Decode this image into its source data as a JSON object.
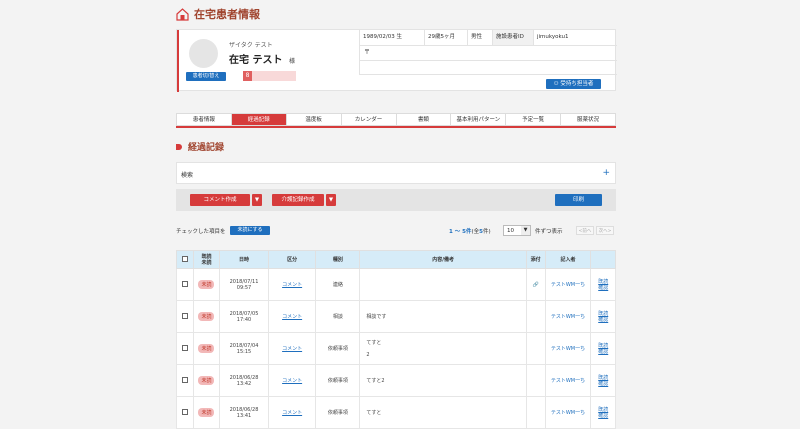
{
  "page": {
    "title": "在宅患者情報"
  },
  "patient": {
    "kana": "ザイタク テスト",
    "name": "在宅 テスト",
    "honorific": "様",
    "switch_button": "患者切/替え",
    "gender_mark": "8",
    "birthdate": "1989/02/03 生",
    "age": "29歳5ヶ月",
    "sex": "男性",
    "facility_label": "施設患者ID",
    "facility_id": "jimukyoku1",
    "postal_mark": "〒",
    "staff_button": "受持ち担当者"
  },
  "tabs": [
    "患者情報",
    "経過記録",
    "温度板",
    "カレンダー",
    "書類",
    "基本利用パターン",
    "予定一覧",
    "服薬状況"
  ],
  "active_tab_index": 1,
  "section": {
    "title": "経過記録"
  },
  "search": {
    "label": "検索",
    "expand": "+"
  },
  "actions": {
    "comment_create": "コメント作成",
    "care_record_create": "介護記録作成",
    "print": "印刷",
    "dropdown": "▼"
  },
  "list_controls": {
    "checked_label": "チェックした項目を",
    "mark_unread": "未読にする",
    "range": "1 ～ 5件",
    "total_prefix": "(全",
    "total": "5",
    "total_suffix": "件)",
    "per_page": "10",
    "per_page_label": "件ずつ表示",
    "prev": "<前へ",
    "next": "次へ>"
  },
  "table": {
    "headers": [
      "",
      "既読\n未読",
      "日時",
      "区分",
      "種別",
      "内容/備考",
      "添付",
      "記入者",
      ""
    ],
    "rows": [
      {
        "status": "未読",
        "date": "2018/07/11",
        "time": "09:57",
        "kubun": "コメント",
        "type": "連絡",
        "content": "",
        "attach": "🔗",
        "author": "テストWM一ち",
        "extra": "既読\n確認"
      },
      {
        "status": "未読",
        "date": "2018/07/05",
        "time": "17:40",
        "kubun": "コメント",
        "type": "相談",
        "content": "相談です",
        "attach": "",
        "author": "テストWM一ち",
        "extra": "既読\n確認"
      },
      {
        "status": "未読",
        "date": "2018/07/04",
        "time": "15:15",
        "kubun": "コメント",
        "type": "依頼事項",
        "content": "てすと\n\n2",
        "attach": "",
        "author": "テストWM一ち",
        "extra": "既読\n確認"
      },
      {
        "status": "未読",
        "date": "2018/06/28",
        "time": "13:42",
        "kubun": "コメント",
        "type": "依頼事項",
        "content": "てすと2",
        "attach": "",
        "author": "テストWM一ち",
        "extra": "既読\n確認"
      },
      {
        "status": "未読",
        "date": "2018/06/28",
        "time": "13:41",
        "kubun": "コメント",
        "type": "依頼事項",
        "content": "てすと",
        "attach": "",
        "author": "テストWM一ち",
        "extra": "既読\n確認"
      }
    ]
  },
  "colors": {
    "accent_red": "#d63b3b",
    "accent_blue": "#1f6fbe",
    "title_brown": "#a0442e"
  }
}
